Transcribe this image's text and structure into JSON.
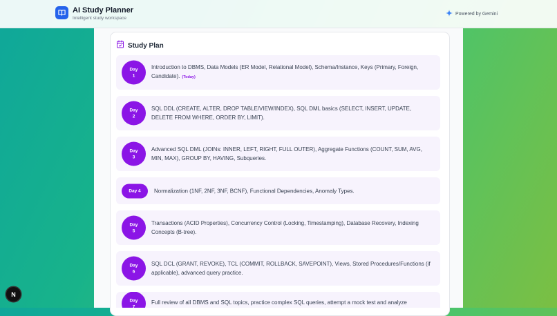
{
  "header": {
    "title": "AI Study Planner",
    "subtitle": "Intelligent study workspace",
    "powered_by": "Powered by Gemini"
  },
  "study_plan": {
    "title": "Study Plan",
    "days": [
      {
        "badge_line1": "Day",
        "badge_line2": "1",
        "text": "Introduction to DBMS, Data Models (ER Model, Relational Model), Schema/Instance, Keys (Primary, Foreign, Candidate).",
        "tag": "(Today)"
      },
      {
        "badge_line1": "Day",
        "badge_line2": "2",
        "text": "SQL DDL (CREATE, ALTER, DROP TABLE/VIEW/INDEX), SQL DML basics (SELECT, INSERT, UPDATE, DELETE FROM WHERE, ORDER BY, LIMIT)."
      },
      {
        "badge_line1": "Day",
        "badge_line2": "3",
        "text": "Advanced SQL DML (JOINs: INNER, LEFT, RIGHT, FULL OUTER), Aggregate Functions (COUNT, SUM, AVG, MIN, MAX), GROUP BY, HAVING, Subqueries."
      },
      {
        "badge": "Day 4",
        "text": "Normalization (1NF, 2NF, 3NF, BCNF), Functional Dependencies, Anomaly Types."
      },
      {
        "badge_line1": "Day",
        "badge_line2": "5",
        "text": "Transactions (ACID Properties), Concurrency Control (Locking, Timestamping), Database Recovery, Indexing Concepts (B-tree)."
      },
      {
        "badge_line1": "Day",
        "badge_line2": "6",
        "text": "SQL DCL (GRANT, REVOKE), TCL (COMMIT, ROLLBACK, SAVEPOINT), Views, Stored Procedures/Functions (if applicable), advanced query practice."
      },
      {
        "badge_line1": "Day",
        "badge_line2": "7",
        "text": "Full review of all DBMS and SQL topics, practice complex SQL queries, attempt a mock test and analyze"
      }
    ]
  },
  "dev_overlay": {
    "label": "N"
  },
  "colors": {
    "accent": "#8b15e6",
    "row_bg": "#f7f3fd",
    "brand": "#2563eb"
  }
}
